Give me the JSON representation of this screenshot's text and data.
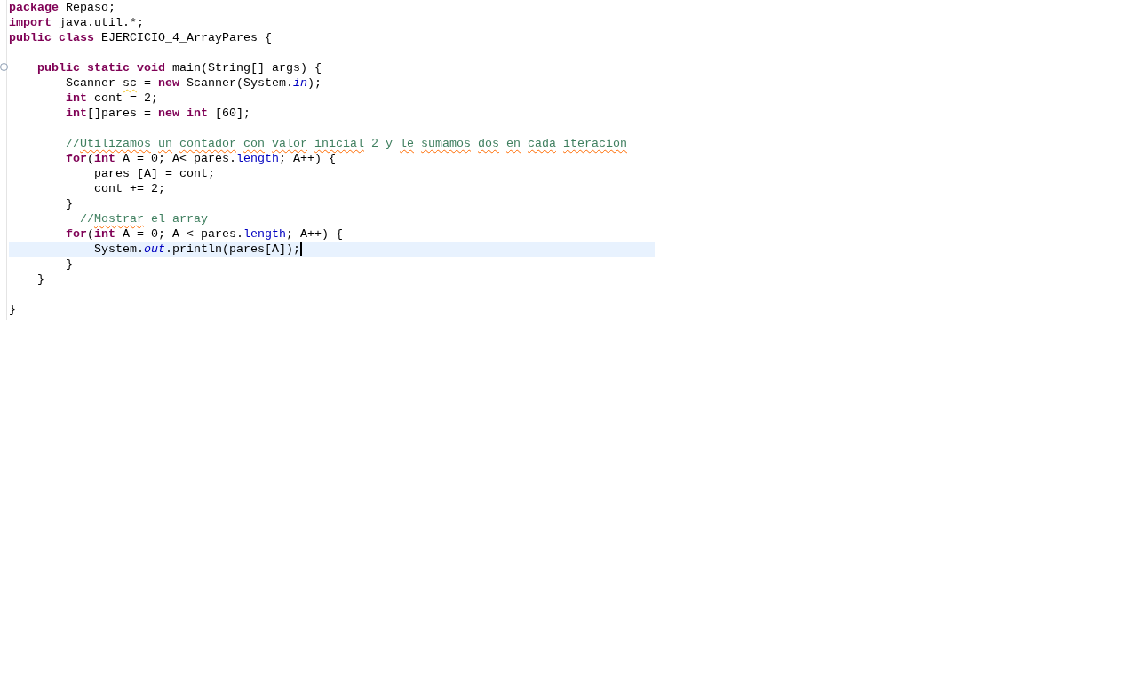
{
  "editor": {
    "lines": [
      {
        "kind": "code",
        "tokens": [
          {
            "text": "package",
            "kind": "keyword"
          },
          {
            "text": " Repaso;",
            "kind": "plain"
          }
        ]
      },
      {
        "kind": "code",
        "tokens": [
          {
            "text": "import",
            "kind": "keyword"
          },
          {
            "text": " java.util.*;",
            "kind": "plain"
          }
        ]
      },
      {
        "kind": "code",
        "tokens": [
          {
            "text": "public",
            "kind": "keyword"
          },
          {
            "text": " class",
            "kind": "keyword"
          },
          {
            "text": " EJERCICIO_4_ArrayPares {",
            "kind": "plain"
          }
        ]
      },
      {
        "kind": "blank"
      },
      {
        "kind": "code",
        "folded": false,
        "tokens": [
          {
            "text": "    public",
            "kind": "keyword"
          },
          {
            "text": " static",
            "kind": "keyword"
          },
          {
            "text": " void",
            "kind": "keyword"
          },
          {
            "text": " main(String[] args) {",
            "kind": "plain"
          }
        ]
      },
      {
        "kind": "code",
        "tokens": [
          {
            "text": "        Scanner",
            "kind": "plain"
          },
          {
            "text": " sc",
            "kind": "plain",
            "warning": true
          },
          {
            "text": " =",
            "kind": "plain"
          },
          {
            "text": " new",
            "kind": "keyword"
          },
          {
            "text": " Scanner(System.",
            "kind": "plain"
          },
          {
            "text": "in",
            "kind": "static-field"
          },
          {
            "text": ");",
            "kind": "plain"
          }
        ]
      },
      {
        "kind": "code",
        "tokens": [
          {
            "text": "        int",
            "kind": "keyword"
          },
          {
            "text": " cont = 2;",
            "kind": "plain"
          }
        ]
      },
      {
        "kind": "code",
        "tokens": [
          {
            "text": "        int",
            "kind": "keyword"
          },
          {
            "text": "[]pares = ",
            "kind": "plain"
          },
          {
            "text": "new",
            "kind": "keyword"
          },
          {
            "text": " int",
            "kind": "keyword"
          },
          {
            "text": " [60];",
            "kind": "plain"
          }
        ]
      },
      {
        "kind": "blank"
      },
      {
        "kind": "code",
        "tokens": [
          {
            "text": "        //",
            "kind": "comment"
          },
          {
            "text": "Utilizamos",
            "kind": "comment",
            "misspelled": true
          },
          {
            "text": " un",
            "kind": "comment",
            "misspelled": true
          },
          {
            "text": " contador",
            "kind": "comment",
            "misspelled": true
          },
          {
            "text": " con",
            "kind": "comment",
            "misspelled": true
          },
          {
            "text": " valor",
            "kind": "comment",
            "misspelled": true
          },
          {
            "text": " inicial",
            "kind": "comment",
            "misspelled": true
          },
          {
            "text": " 2 y",
            "kind": "comment"
          },
          {
            "text": " le",
            "kind": "comment",
            "misspelled": true
          },
          {
            "text": " sumamos",
            "kind": "comment",
            "misspelled": true
          },
          {
            "text": " dos",
            "kind": "comment",
            "misspelled": true
          },
          {
            "text": " en",
            "kind": "comment",
            "misspelled": true
          },
          {
            "text": " cada",
            "kind": "comment",
            "misspelled": true
          },
          {
            "text": " iteracion",
            "kind": "comment",
            "misspelled": true
          }
        ]
      },
      {
        "kind": "code",
        "tokens": [
          {
            "text": "        for",
            "kind": "keyword"
          },
          {
            "text": "(",
            "kind": "plain"
          },
          {
            "text": "int",
            "kind": "keyword"
          },
          {
            "text": " A = 0; A< pares.",
            "kind": "plain"
          },
          {
            "text": "length",
            "kind": "field"
          },
          {
            "text": "; A++) {",
            "kind": "plain"
          }
        ]
      },
      {
        "kind": "code",
        "tokens": [
          {
            "text": "            pares [A] = cont;",
            "kind": "plain"
          }
        ]
      },
      {
        "kind": "code",
        "tokens": [
          {
            "text": "            cont += 2;",
            "kind": "plain"
          }
        ]
      },
      {
        "kind": "code",
        "tokens": [
          {
            "text": "        }",
            "kind": "plain"
          }
        ]
      },
      {
        "kind": "code",
        "tokens": [
          {
            "text": "          //",
            "kind": "comment"
          },
          {
            "text": "Mostrar",
            "kind": "comment",
            "misspelled": true
          },
          {
            "text": " el array",
            "kind": "comment"
          }
        ]
      },
      {
        "kind": "code",
        "tokens": [
          {
            "text": "        for",
            "kind": "keyword"
          },
          {
            "text": "(",
            "kind": "plain"
          },
          {
            "text": "int",
            "kind": "keyword"
          },
          {
            "text": " A = 0; A < pares.",
            "kind": "plain"
          },
          {
            "text": "length",
            "kind": "field"
          },
          {
            "text": "; A++) {",
            "kind": "plain"
          }
        ]
      },
      {
        "kind": "code",
        "current": true,
        "tokens": [
          {
            "text": "            System.",
            "kind": "plain"
          },
          {
            "text": "out",
            "kind": "static-field"
          },
          {
            "text": ".println(pares[A]);",
            "kind": "plain"
          }
        ]
      },
      {
        "kind": "code",
        "tokens": [
          {
            "text": "        }",
            "kind": "plain"
          }
        ]
      },
      {
        "kind": "code",
        "tokens": [
          {
            "text": "    }",
            "kind": "plain"
          }
        ]
      },
      {
        "kind": "blank"
      },
      {
        "kind": "code",
        "tokens": [
          {
            "text": "}",
            "kind": "plain"
          }
        ]
      }
    ]
  }
}
